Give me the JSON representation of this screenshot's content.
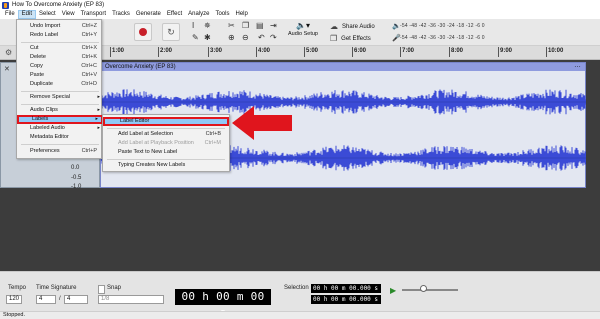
{
  "window": {
    "title": "How To Overcome Anxiety (EP 83)"
  },
  "menubar": [
    "File",
    "Edit",
    "Select",
    "View",
    "Transport",
    "Tracks",
    "Generate",
    "Effect",
    "Analyze",
    "Tools",
    "Help"
  ],
  "toolbar": {
    "audio_setup": "Audio Setup",
    "share_audio": "Share Audio",
    "get_effects": "Get Effects",
    "meter_scale": "-54 -48 -42 -36 -30 -24 -18 -12 -6 0"
  },
  "ruler": {
    "ticks": [
      "1:00",
      "2:00",
      "3:00",
      "4:00",
      "5:00",
      "6:00",
      "7:00",
      "8:00",
      "9:00",
      "10:00"
    ]
  },
  "track": {
    "clip_title": "Overcome Anxiety (EP 83)",
    "scale": [
      "0.0",
      "-0.5",
      "-1.0"
    ]
  },
  "edit_menu": {
    "items": [
      {
        "label": "Undo Import",
        "shortcut": "Ctrl+Z"
      },
      {
        "label": "Redo Label",
        "shortcut": "Ctrl+Y"
      },
      {
        "label": "Cut",
        "shortcut": "Ctrl+X"
      },
      {
        "label": "Delete",
        "shortcut": "Ctrl+K"
      },
      {
        "label": "Copy",
        "shortcut": "Ctrl+C"
      },
      {
        "label": "Paste",
        "shortcut": "Ctrl+V"
      },
      {
        "label": "Duplicate",
        "shortcut": "Ctrl+D"
      },
      {
        "label": "Remove Special",
        "shortcut": ""
      },
      {
        "label": "Audio Clips",
        "shortcut": ""
      },
      {
        "label": "Labels",
        "shortcut": ""
      },
      {
        "label": "Labeled Audio",
        "shortcut": ""
      },
      {
        "label": "Metadata Editor",
        "shortcut": ""
      },
      {
        "label": "Preferences",
        "shortcut": "Ctrl+P"
      }
    ]
  },
  "labels_submenu": {
    "items": [
      {
        "label": "Label Editor",
        "shortcut": ""
      },
      {
        "label": "Add Label at Selection",
        "shortcut": "Ctrl+B"
      },
      {
        "label": "Add Label at Playback Position",
        "shortcut": "Ctrl+M"
      },
      {
        "label": "Paste Text to New Label",
        "shortcut": ""
      },
      {
        "label": "Typing Creates New Labels",
        "shortcut": ""
      }
    ]
  },
  "bottom": {
    "tempo_label": "Tempo",
    "tempo_value": "120",
    "time_signature_label": "Time Signature",
    "ts_numerator": "4",
    "ts_slash": "/",
    "ts_denominator": "4",
    "snap_label": "Snap",
    "snap_value": "1/8",
    "time_display": "00 h 00 m 00 s",
    "selection_label": "Selection",
    "selection_start": "00 h 00 m 00.000 s",
    "selection_end": "00 h 00 m 00.000 s"
  },
  "status": {
    "text": "Stopped."
  },
  "colors": {
    "waveform": "#3b4bd6",
    "highlight": "#91c9f7",
    "annotation_red": "#e0151d"
  }
}
